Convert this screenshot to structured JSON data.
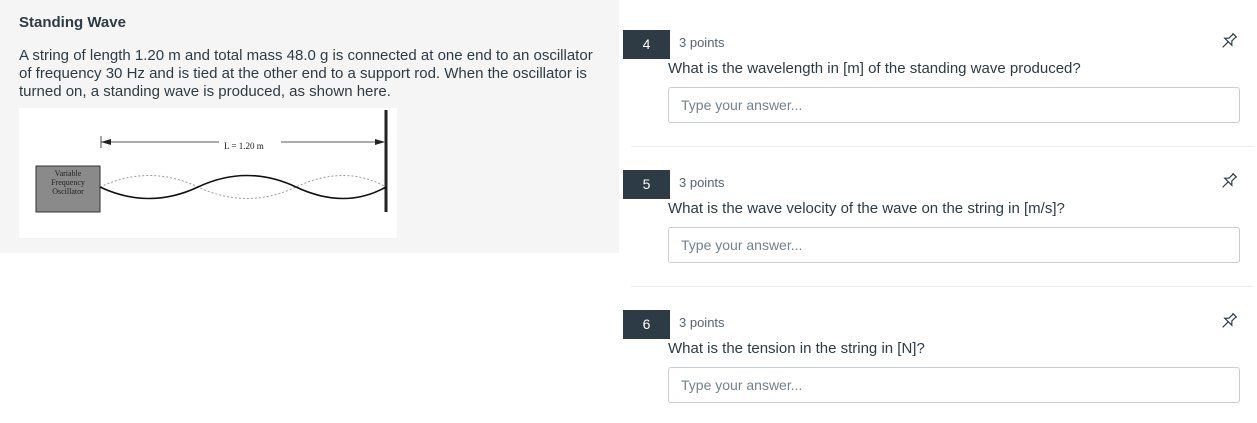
{
  "problem": {
    "title": "Standing Wave",
    "description": "A string of length 1.20 m and total mass 48.0 g is connected at one end to an oscillator of frequency 30 Hz and is tied at the other end to a support rod. When the oscillator is turned on, a standing wave is produced, as shown here.",
    "figure": {
      "length_label": "L = 1.20 m",
      "oscillator_label_lines": [
        "Variable",
        "Frequency",
        "Oscillator"
      ]
    }
  },
  "questions": [
    {
      "number": "4",
      "points": "3 points",
      "text": "What is the wavelength in [m] of the standing wave produced?",
      "placeholder": "Type your answer...",
      "value": ""
    },
    {
      "number": "5",
      "points": "3 points",
      "text": "What is the wave velocity of the wave on the string in [m/s]?",
      "placeholder": "Type your answer...",
      "value": ""
    },
    {
      "number": "6",
      "points": "3 points",
      "text": "What is the tension in the string in [N]?",
      "placeholder": "Type your answer...",
      "value": ""
    }
  ],
  "icons": {
    "pin": "pin-icon"
  },
  "colors": {
    "badge_background": "#2d3b45",
    "panel_background": "#f5f5f5",
    "input_border": "#c7cdd1"
  }
}
